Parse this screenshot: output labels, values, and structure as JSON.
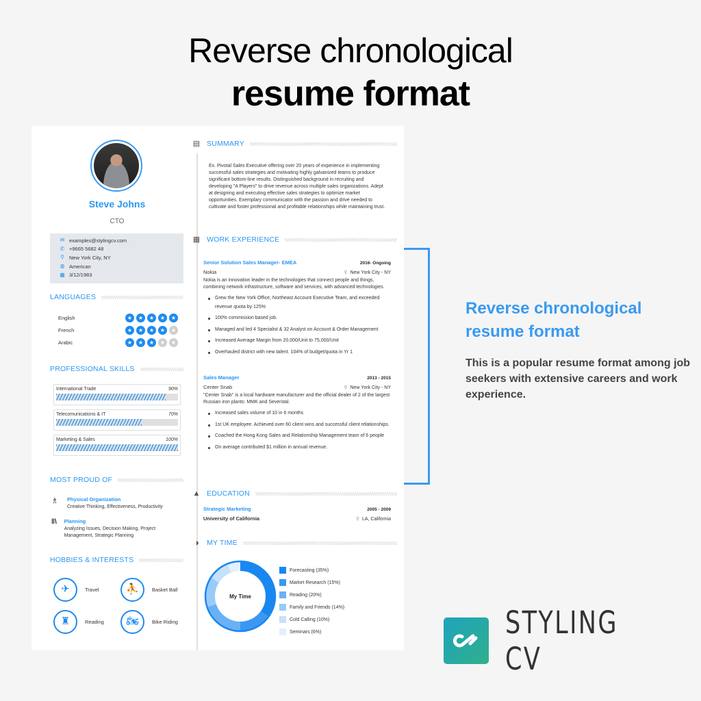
{
  "page_title": {
    "line1": "Reverse chronological",
    "line2": "resume format"
  },
  "resume": {
    "name": "Steve Johns",
    "role": "CTO",
    "contact": [
      {
        "icon": "email-icon",
        "glyph": "✉",
        "text": "examples@stylingcv.com"
      },
      {
        "icon": "phone-icon",
        "glyph": "✆",
        "text": "+9665 5682 48"
      },
      {
        "icon": "location-icon",
        "glyph": "⚲",
        "text": "New York City, NY"
      },
      {
        "icon": "globe-icon",
        "glyph": "◍",
        "text": "American"
      },
      {
        "icon": "calendar-icon",
        "glyph": "▦",
        "text": "3/12/1983"
      }
    ],
    "languages": {
      "heading": "LANGUAGES",
      "items": [
        {
          "name": "English",
          "rating": 5,
          "max": 5
        },
        {
          "name": "French",
          "rating": 4,
          "max": 5
        },
        {
          "name": "Arabic",
          "rating": 3,
          "max": 5
        }
      ]
    },
    "skills": {
      "heading": "PROFESSIONAL SKILLS",
      "items": [
        {
          "name": "International Trade",
          "percent_label": "90%",
          "value": 90
        },
        {
          "name": "Telecomunications & IT",
          "percent_label": "70%",
          "value": 70
        },
        {
          "name": "Marketing & Sales",
          "percent_label": "100%",
          "value": 100
        }
      ]
    },
    "proud": {
      "heading": "MOST PROUD OF",
      "items": [
        {
          "icon": "trophy-icon",
          "glyph": "🏆",
          "title": "Physical Organization",
          "desc": "Creative Thinking, Effectiveness, Productivity"
        },
        {
          "icon": "books-icon",
          "glyph": "📚",
          "title": "Planning",
          "desc": "Analyzing Issues, Decision Making, Project Management, Strategic Planning"
        }
      ]
    },
    "hobbies": {
      "heading": "HOBBIES & INTERESTS",
      "items": [
        {
          "icon": "plane-icon",
          "glyph": "✈",
          "label": "Travel"
        },
        {
          "icon": "basketball-icon",
          "glyph": "⛹",
          "label": "Basket Ball"
        },
        {
          "icon": "reading-icon",
          "glyph": "♜",
          "label": "Reading"
        },
        {
          "icon": "bike-icon",
          "glyph": "🏍",
          "label": "Bike Riding"
        }
      ]
    },
    "summary": {
      "heading": "SUMMARY",
      "text": "Ex. Pivotal Sales Executive offering over 20 years of experience in implementing successful sales strategies and motivating highly galvanized teams to produce significant bottom-line results. Distinguished background in recruiting and developing \"A Players\" to drive revenue across multiple sales organizations. Adept at designing and executing effective sales strategies to optimize market opportunities. Exemplary communicator with the passion and drive needed to cultivate and foster professional and profitable relationships while maintaining trust."
    },
    "work": {
      "heading": "WORK EXPERIENCE",
      "jobs": [
        {
          "title": "Senior Solution Sales Manager- EMEA",
          "dates": "2016- Ongoing",
          "company": "Nokia",
          "location": "New York City - NY",
          "desc": "Nokia is an innovation leader in the technologies that connect people and things, combining network infrastructure, software and services, with advanced technologies.",
          "bullets": [
            "Grew the New York Office, Northeast Account Executive Team, and exceeded revenue quota by 125%",
            "100% commission based job.",
            "Managed and led 4 Specialist & 32 Analyst on Account & Order Management",
            "Increased Average Margin from 20,000/Unit to 75,000/Unit",
            "Overhauled district with new talent. 104% of budget/quota in Yr 1"
          ]
        },
        {
          "title": "Sales Manager",
          "dates": "2013 - 2015",
          "company": "Center Snab",
          "location": "New York City - NY",
          "desc": "\"Center Snab\" is a local hardware manufacturer and the official dealer of 2 of the largest Russian iron plants: MMK and Severstal.",
          "bullets": [
            "Increased sales volume of 10 in 6 months",
            "1st UK employee. Achieved over 60 client wins and successful client relationships.",
            "Coached the Hong Kong Sales and Relationship Management team of 6 people",
            "On average contributed $1 million in annual revenue."
          ]
        }
      ]
    },
    "education": {
      "heading": "EDUCATION",
      "title": "Strategic Marketing",
      "dates": "2005 - 2009",
      "school": "University of California",
      "location": "LA, California"
    },
    "my_time": {
      "heading": "MY TIME",
      "center_label": "My Time"
    }
  },
  "chart_data": {
    "type": "pie",
    "title": "My Time",
    "categories": [
      "Forecasting",
      "Market Research",
      "Reading",
      "Family and Friends",
      "Cold Calling",
      "Seminars"
    ],
    "values": [
      35,
      15,
      20,
      14,
      10,
      6
    ],
    "labels": [
      "Forecasting (35%)",
      "Market Research (15%)",
      "Reading (20%)",
      "Family and Friends (14%)",
      "Cold Calling (10%)",
      "Seminars (6%)"
    ],
    "colors": [
      "#1a87f0",
      "#3a98f2",
      "#69b1f5",
      "#99cbf8",
      "#c6e1fb",
      "#e3f0fd"
    ],
    "legend": "right"
  },
  "callout": {
    "title": "Reverse chronological resume format",
    "body": "This is a popular resume format among job seekers with extensive careers and work experience."
  },
  "brand": {
    "name": "STYLING",
    "suffix": "CV"
  },
  "colors": {
    "accent": "#2b95f0",
    "callout": "#3a9af0",
    "brand_start": "#1fa3bd",
    "brand_end": "#2fb08c"
  }
}
